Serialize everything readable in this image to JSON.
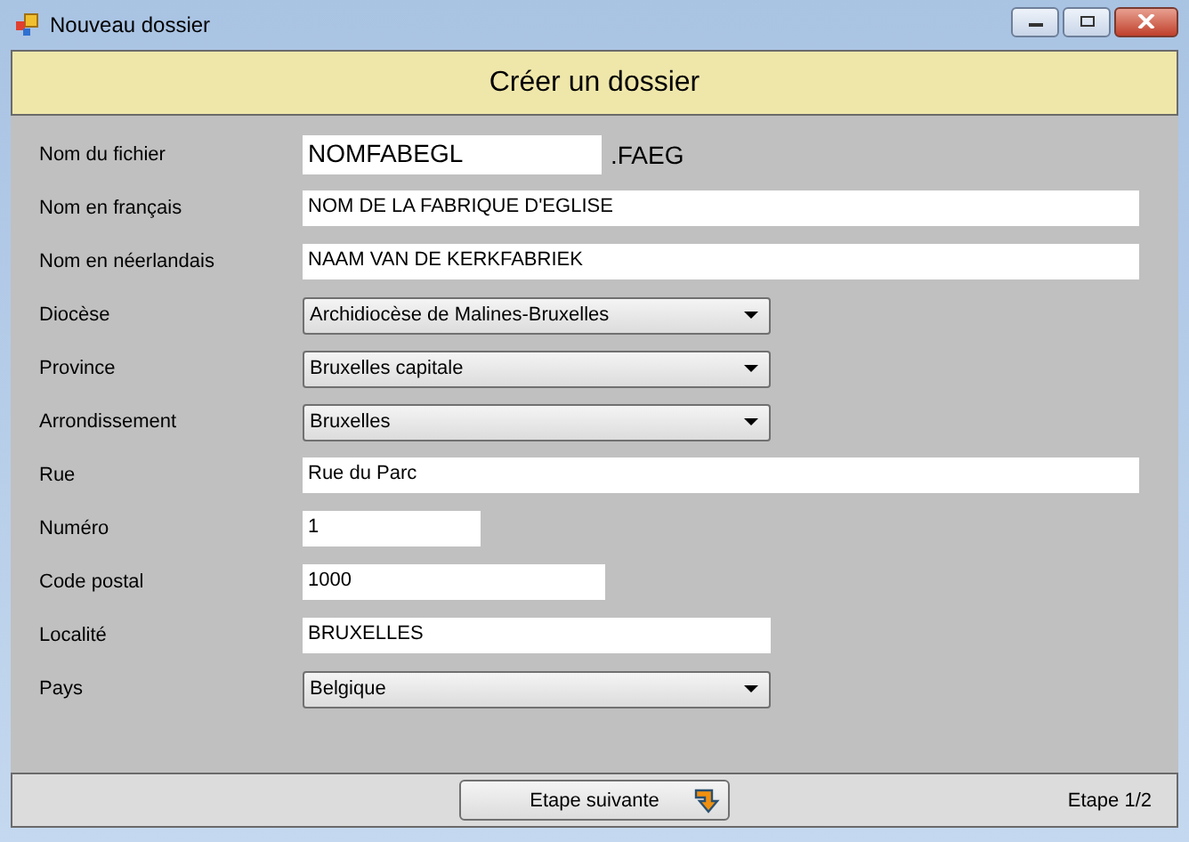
{
  "window": {
    "title": "Nouveau dossier"
  },
  "header": {
    "title": "Créer un dossier"
  },
  "fields": [
    {
      "label": "Nom du fichier",
      "kind": "text",
      "value": "NOMFABEGL",
      "suffix": ".FAEG"
    },
    {
      "label": "Nom en français",
      "kind": "text",
      "value": "NOM DE LA FABRIQUE D'EGLISE"
    },
    {
      "label": "Nom en néerlandais",
      "kind": "text",
      "value": "NAAM VAN DE KERKFABRIEK"
    },
    {
      "label": "Diocèse",
      "kind": "combo",
      "value": "Archidiocèse de Malines-Bruxelles"
    },
    {
      "label": "Province",
      "kind": "combo",
      "value": "Bruxelles capitale"
    },
    {
      "label": "Arrondissement",
      "kind": "combo",
      "value": "Bruxelles"
    },
    {
      "label": "Rue",
      "kind": "text",
      "value": "Rue du Parc"
    },
    {
      "label": "Numéro",
      "kind": "text",
      "value": "1"
    },
    {
      "label": "Code postal",
      "kind": "text",
      "value": "1000"
    },
    {
      "label": "Localité",
      "kind": "text",
      "value": "BRUXELLES"
    },
    {
      "label": "Pays",
      "kind": "combo",
      "value": "Belgique"
    }
  ],
  "footer": {
    "button": "Etape suivante",
    "step": "Etape 1/2"
  }
}
